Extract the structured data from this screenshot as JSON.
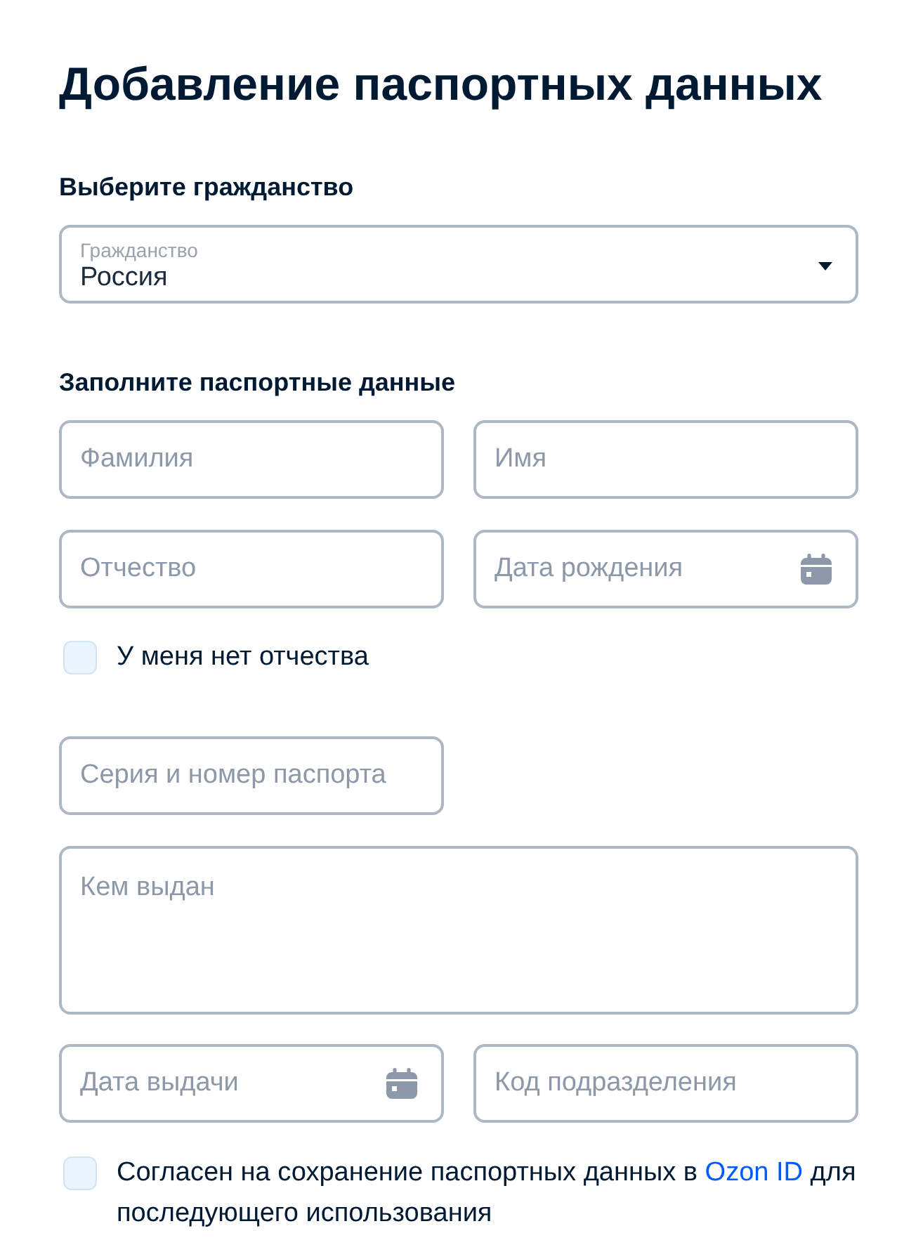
{
  "title": "Добавление паспортных данных",
  "citizenship": {
    "heading": "Выберите гражданство",
    "select": {
      "label": "Гражданство",
      "value": "Россия"
    }
  },
  "passport": {
    "heading": "Заполните паспортные данные",
    "items": [
      {
        "kind": "row",
        "fields": [
          {
            "kind": "text",
            "placeholder": "Фамилия"
          },
          {
            "kind": "text",
            "placeholder": "Имя"
          }
        ]
      },
      {
        "kind": "row",
        "fields": [
          {
            "kind": "text",
            "placeholder": "Отчество"
          },
          {
            "kind": "date",
            "placeholder": "Дата рождения"
          }
        ]
      },
      {
        "kind": "checkbox",
        "label": "У меня нет отчества",
        "checked": false
      },
      {
        "kind": "row",
        "fields": [
          {
            "kind": "text",
            "placeholder": "Серия и номер паспорта"
          }
        ]
      },
      {
        "kind": "textarea",
        "placeholder": "Кем выдан"
      },
      {
        "kind": "row",
        "fields": [
          {
            "kind": "date",
            "placeholder": "Дата выдачи"
          },
          {
            "kind": "text",
            "placeholder": "Код подразделения"
          }
        ]
      }
    ]
  },
  "consent": {
    "checked": false,
    "text_before": "Согласен на сохранение паспортных данных в",
    "link": "Ozon ID",
    "text_after": "для последующего использования"
  }
}
